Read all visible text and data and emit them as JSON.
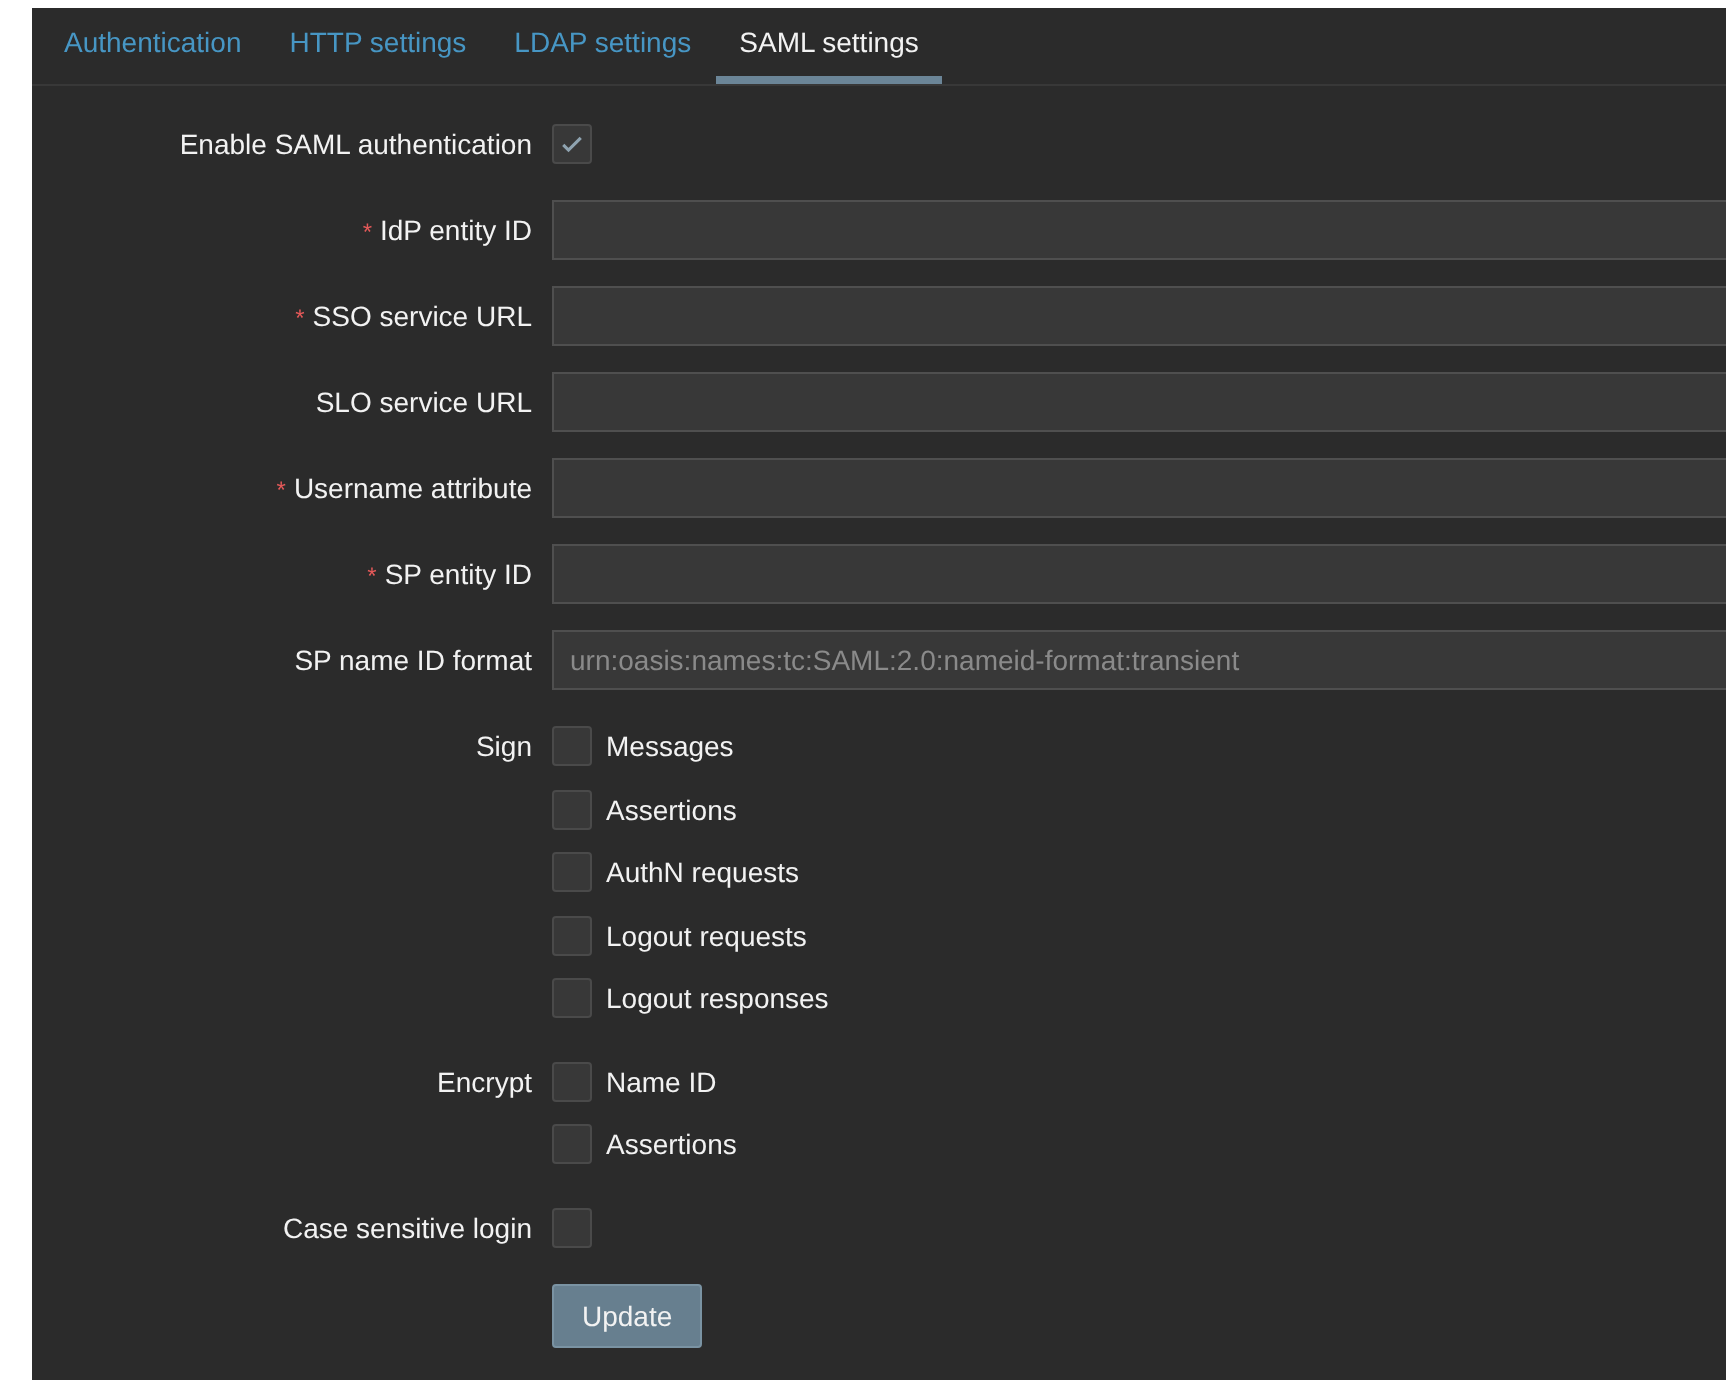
{
  "tabs": [
    {
      "label": "Authentication",
      "selected": false
    },
    {
      "label": "HTTP settings",
      "selected": false
    },
    {
      "label": "LDAP settings",
      "selected": false
    },
    {
      "label": "SAML settings",
      "selected": true
    }
  ],
  "form": [
    {
      "kind": "checkbox",
      "label": "Enable SAML authentication",
      "checked": true
    },
    {
      "kind": "text",
      "required_mark": "*",
      "label": "IdP entity ID"
    },
    {
      "kind": "text",
      "required_mark": "*",
      "label": "SSO service URL"
    },
    {
      "kind": "text",
      "label": "SLO service URL"
    },
    {
      "kind": "text",
      "required_mark": "*",
      "label": "Username attribute"
    },
    {
      "kind": "text",
      "required_mark": "*",
      "label": "SP entity ID"
    },
    {
      "kind": "text",
      "label": "SP name ID format",
      "placeholder": "urn:oasis:names:tc:SAML:2.0:nameid-format:transient"
    },
    {
      "kind": "group",
      "label": "Sign",
      "options": [
        {
          "label": "Messages",
          "checked": false
        },
        {
          "label": "Assertions",
          "checked": false
        },
        {
          "label": "AuthN requests",
          "checked": false
        },
        {
          "label": "Logout requests",
          "checked": false
        },
        {
          "label": "Logout responses",
          "checked": false
        }
      ]
    },
    {
      "kind": "group",
      "label": "Encrypt",
      "options": [
        {
          "label": "Name ID",
          "checked": false
        },
        {
          "label": "Assertions",
          "checked": false
        }
      ]
    },
    {
      "kind": "checkbox",
      "label": "Case sensitive login",
      "checked": false
    }
  ],
  "submit": "Update"
}
